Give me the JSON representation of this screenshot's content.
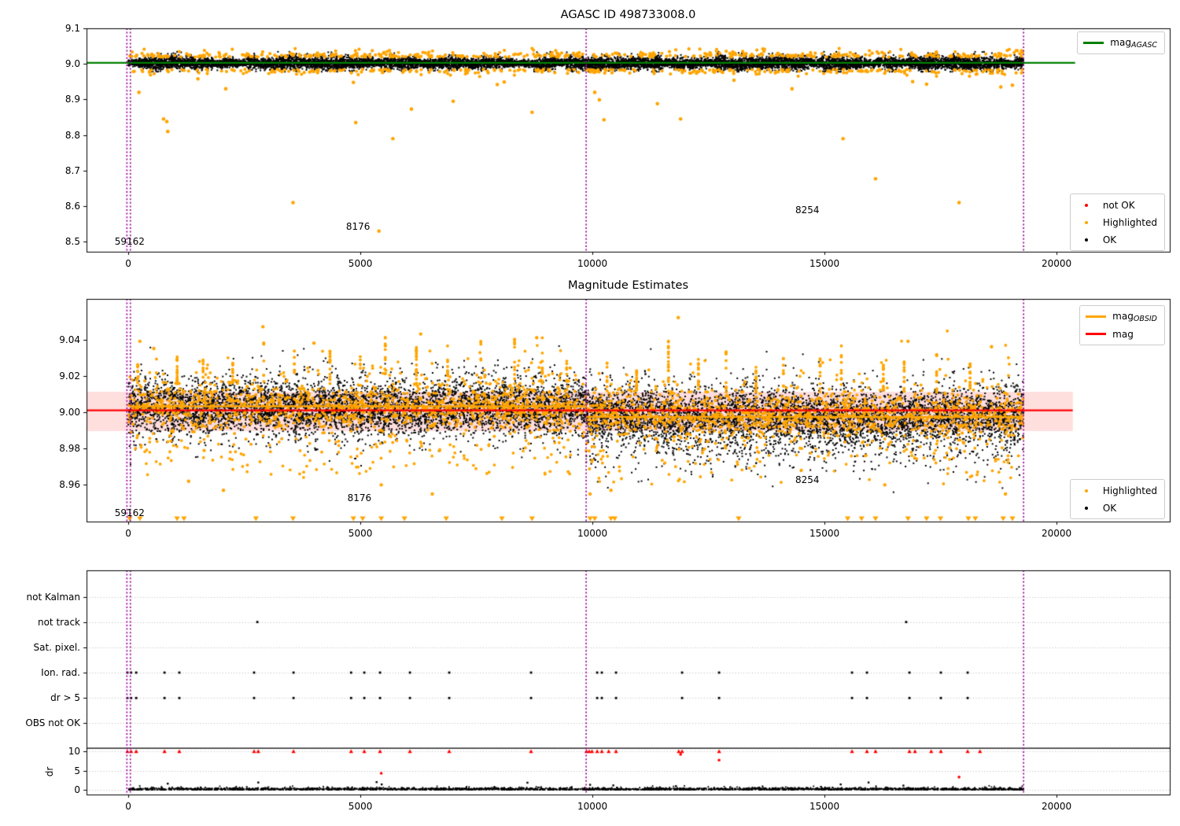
{
  "colors": {
    "mag_agasc_line": "#008000",
    "highlighted": "#ffa500",
    "not_ok": "#ff0000",
    "ok": "#000000",
    "mag_line": "#ff0000",
    "mag_obsid_line": "#ffa500",
    "obsid_boundary_line": "#9c009c",
    "mag_err_band": "rgba(255,0,0,0.13)",
    "grid": "#bbbbbb"
  },
  "chart_data": [
    {
      "id": "agasc-mag-overview",
      "type": "scatter",
      "title": "AGASC ID 498733008.0",
      "xlim": [
        -900,
        22440
      ],
      "ylim": [
        8.472,
        9.1
      ],
      "xticks": [
        0,
        5000,
        10000,
        15000,
        20000
      ],
      "yticks": [
        "9.1",
        "9.0",
        "8.9",
        "8.8",
        "8.7",
        "8.6",
        "8.5"
      ],
      "legends": {
        "line": {
          "label": "mag",
          "sub": "AGASC",
          "color": "#008000"
        },
        "points": [
          {
            "label": "not OK",
            "color": "#ff0000"
          },
          {
            "label": "Highlighted",
            "color": "#ffa500"
          },
          {
            "label": "OK",
            "color": "#000000"
          }
        ]
      },
      "mag_agasc": 9.003,
      "mag_line_span": [
        -900,
        20400
      ],
      "vlines": [
        -30,
        45,
        9865,
        19290
      ],
      "annotations": [
        {
          "text": "59162",
          "x": 30,
          "y": 8.5
        },
        {
          "text": "8176",
          "x": 4950,
          "y": 8.543
        },
        {
          "text": "8254",
          "x": 14630,
          "y": 8.589
        }
      ],
      "cloud": {
        "x_min": 0,
        "x_max": 19290,
        "center": 9.002,
        "sigma": 0.0085,
        "clip_lo": 8.978,
        "clip_hi": 9.034,
        "n_black": 12000,
        "n_orange_fringe": 720
      },
      "highlighted_outliers": [
        [
          230,
          8.92
        ],
        [
          760,
          8.845
        ],
        [
          830,
          8.838
        ],
        [
          850,
          8.81
        ],
        [
          1500,
          8.958
        ],
        [
          2100,
          8.93
        ],
        [
          3550,
          8.61
        ],
        [
          4850,
          8.948
        ],
        [
          4900,
          8.835
        ],
        [
          5400,
          8.53
        ],
        [
          5700,
          8.79
        ],
        [
          6100,
          8.873
        ],
        [
          7000,
          8.895
        ],
        [
          7950,
          8.942
        ],
        [
          8100,
          8.949
        ],
        [
          8700,
          8.864
        ],
        [
          10050,
          8.92
        ],
        [
          10150,
          8.899
        ],
        [
          10250,
          8.843
        ],
        [
          11400,
          8.888
        ],
        [
          11900,
          8.845
        ],
        [
          13050,
          8.954
        ],
        [
          14300,
          8.93
        ],
        [
          15400,
          8.79
        ],
        [
          16100,
          8.677
        ],
        [
          16900,
          8.95
        ],
        [
          17200,
          8.943
        ],
        [
          17900,
          8.61
        ],
        [
          18800,
          8.935
        ],
        [
          19050,
          8.94
        ]
      ]
    },
    {
      "id": "magnitude-estimates",
      "type": "scatter",
      "title": "Magnitude Estimates",
      "xlim": [
        -900,
        22440
      ],
      "ylim": [
        8.9398,
        9.0623
      ],
      "xticks": [
        0,
        5000,
        10000,
        15000,
        20000
      ],
      "yticks": [
        "9.04",
        "9.02",
        "9.00",
        "8.98",
        "8.96"
      ],
      "legends": {
        "lines": [
          {
            "label": "mag",
            "sub": "OBSID",
            "color": "#ffa500"
          },
          {
            "label": "mag",
            "sub": "",
            "color": "#ff0000"
          }
        ],
        "points": [
          {
            "label": "Highlighted",
            "color": "#ffa500"
          },
          {
            "label": "OK",
            "color": "#000000"
          }
        ]
      },
      "mag": 9.001,
      "mag_err_band": [
        8.9896,
        9.0112
      ],
      "mag_line_span": [
        -900,
        20350
      ],
      "mag_obsid_segments": [
        {
          "x0": 60,
          "x1": 9865,
          "y": 9.0032
        },
        {
          "x0": 9865,
          "x1": 19290,
          "y": 8.9974
        }
      ],
      "vlines": [
        -30,
        45,
        9865,
        19290
      ],
      "annotations": [
        {
          "text": "59162",
          "x": 30,
          "y": 8.9446
        },
        {
          "text": "8176",
          "x": 4980,
          "y": 8.953
        },
        {
          "text": "8254",
          "x": 14630,
          "y": 8.9628
        }
      ],
      "cloud": {
        "x_min": 0,
        "x_max": 19290,
        "split_x": 9865,
        "center_left": 9.0035,
        "center_right": 8.9985,
        "sigma_core": 0.0055,
        "clip_lo": 8.947,
        "clip_hi": 9.056,
        "n_black": 11000,
        "n_orange": 3000
      },
      "clipped_low_x": [
        30,
        250,
        1050,
        1200,
        2750,
        3550,
        4850,
        5050,
        5450,
        5950,
        6850,
        8050,
        8700,
        9950,
        10050,
        10400,
        10480,
        13150,
        15500,
        15800,
        16100,
        16800,
        17200,
        17500,
        18100,
        18250,
        18850,
        19050
      ],
      "highlighted_outliers": [
        [
          250,
          9.039
        ],
        [
          550,
          9.035
        ],
        [
          2900,
          9.047
        ],
        [
          4000,
          9.038
        ],
        [
          6300,
          9.043
        ],
        [
          8800,
          9.041
        ],
        [
          11850,
          9.052
        ],
        [
          16800,
          9.039
        ],
        [
          18600,
          9.036
        ],
        [
          1300,
          8.962
        ],
        [
          2050,
          8.957
        ],
        [
          5450,
          8.96
        ],
        [
          6550,
          8.955
        ],
        [
          9950,
          8.955
        ],
        [
          10400,
          8.957
        ],
        [
          14500,
          8.968
        ],
        [
          16300,
          8.96
        ],
        [
          18900,
          8.955
        ]
      ]
    },
    {
      "id": "flags-and-dr",
      "type": "scatter-categorical",
      "rows": [
        "not Kalman",
        "not track",
        "Sat. pixel.",
        "Ion. rad.",
        "dr > 5",
        "OBS not OK"
      ],
      "ylabel": "dr",
      "dr_ticks": [
        10,
        5,
        0
      ],
      "xticks": [
        0,
        5000,
        10000,
        15000,
        20000
      ],
      "xlim": [
        -900,
        22440
      ],
      "vlines": [
        -30,
        45,
        9865,
        19290
      ],
      "separator_dr": 10.8,
      "flag_points": {
        "not Kalman": [],
        "not track": [
          2780,
          16760
        ],
        "Sat. pixel.": [],
        "Ion. rad.": [
          -20,
          60,
          170,
          780,
          1100,
          2710,
          3560,
          4800,
          5085,
          5424,
          6068,
          6915,
          8678,
          10102,
          10203,
          10509,
          11932,
          12729,
          15593,
          15915,
          16831,
          17508,
          18085
        ],
        "dr > 5": [
          -20,
          60,
          170,
          780,
          1100,
          2710,
          3560,
          4800,
          5085,
          5424,
          6068,
          6915,
          8678,
          10102,
          10203,
          10509,
          11932,
          12729,
          15593,
          15915,
          16831,
          17508,
          18085
        ],
        "OBS not OK": []
      },
      "dr_clipped_red_x": [
        -20,
        60,
        170,
        780,
        1100,
        2710,
        2800,
        3560,
        4800,
        5085,
        5424,
        6068,
        6915,
        8678,
        9870,
        9930,
        9990,
        10102,
        10203,
        10350,
        10509,
        11860,
        11932,
        12729,
        15593,
        15915,
        16100,
        16831,
        16950,
        17300,
        17508,
        18085,
        18350
      ],
      "dr_red_points": [
        [
          11900,
          9.2
        ],
        [
          12729,
          7.7
        ],
        [
          5450,
          4.3
        ],
        [
          17900,
          3.3
        ]
      ],
      "dr_black": {
        "x_min": 0,
        "x_max": 19290,
        "n": 2800,
        "typ": 0.25,
        "spikes": [
          [
            850,
            1.6
          ],
          [
            2800,
            1.9
          ],
          [
            5350,
            2.0
          ],
          [
            5460,
            1.4
          ],
          [
            8600,
            1.85
          ],
          [
            9950,
            1.3
          ],
          [
            10450,
            1.15
          ],
          [
            11800,
            0.95
          ],
          [
            15350,
            1.4
          ],
          [
            15950,
            1.9
          ],
          [
            16700,
            1.1
          ]
        ]
      }
    }
  ]
}
